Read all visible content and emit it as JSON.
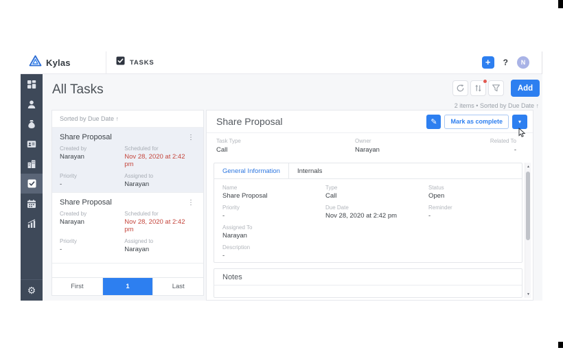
{
  "header": {
    "brand": "Kylas",
    "nav_tab": "TASKS",
    "add_glyph": "+",
    "help_label": "?",
    "avatar_initial": "N"
  },
  "toolbar": {
    "title": "All Tasks",
    "add_label": "Add",
    "summary": "2 items • Sorted by Due Date ↑"
  },
  "task_list": {
    "sorted_by": "Sorted by Due Date ↑",
    "cards": [
      {
        "title": "Share Proposal",
        "created_by_label": "Created by",
        "created_by": "Narayan",
        "scheduled_label": "Scheduled for",
        "scheduled": "Nov 28, 2020 at 2:42 pm",
        "priority_label": "Priority",
        "priority": "-",
        "assigned_label": "Assigned to",
        "assigned": "Narayan"
      },
      {
        "title": "Share Proposal",
        "created_by_label": "Created by",
        "created_by": "Narayan",
        "scheduled_label": "Scheduled for",
        "scheduled": "Nov 28, 2020 at 2:42 pm",
        "priority_label": "Priority",
        "priority": "-",
        "assigned_label": "Assigned to",
        "assigned": "Narayan"
      }
    ],
    "pagination": {
      "first": "First",
      "page": "1",
      "last": "Last"
    }
  },
  "detail": {
    "title": "Share Proposal",
    "mark_complete_label": "Mark as complete",
    "summary": [
      {
        "label": "Task Type",
        "value": "Call"
      },
      {
        "label": "Owner",
        "value": "Narayan"
      },
      {
        "label": "Related To",
        "value": "-"
      }
    ],
    "tabs": [
      "General Information",
      "Internals"
    ],
    "fields": [
      {
        "label": "Name",
        "value": "Share Proposal"
      },
      {
        "label": "Type",
        "value": "Call"
      },
      {
        "label": "Status",
        "value": "Open"
      },
      {
        "label": "Priority",
        "value": "-"
      },
      {
        "label": "Due Date",
        "value": "Nov 28, 2020 at 2:42 pm"
      },
      {
        "label": "Reminder",
        "value": "-"
      },
      {
        "label": "Assigned To",
        "value": "Narayan"
      },
      {
        "label": "Description",
        "value": "-"
      }
    ],
    "notes_title": "Notes"
  },
  "icons": {
    "kebab": "⋮",
    "caret_down": "▾",
    "pencil": "✎",
    "gear": "⚙",
    "scroll_up": "▲",
    "scroll_down": "▼"
  },
  "colors": {
    "accent_blue": "#2d7ff0",
    "sidebar_bg": "#3e4959",
    "overdue_red": "#c4453c",
    "avatar_bg": "#a9b3e6",
    "content_bg": "#f6f7f9"
  }
}
